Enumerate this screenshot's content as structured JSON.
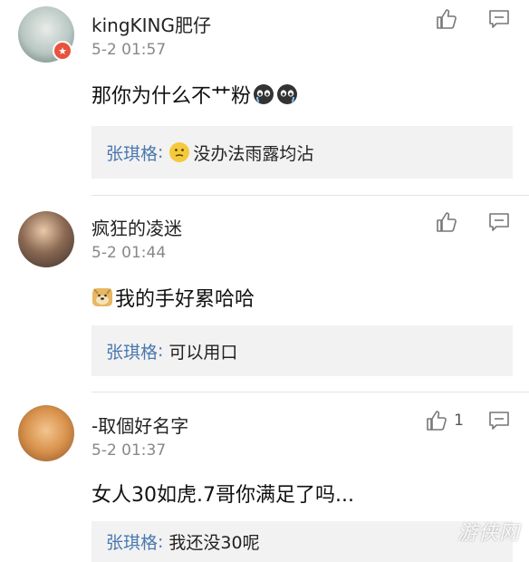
{
  "comments": [
    {
      "username": "kingKING肥仔",
      "time": "5-2 01:57",
      "text": "那你为什么不艹粉",
      "like_count": "",
      "reply": {
        "name": "张琪格",
        "separator": ":",
        "text": "没办法雨露均沾"
      }
    },
    {
      "username": "疯狂的凌迷",
      "time": "5-2 01:44",
      "text": "我的手好累哈哈",
      "like_count": "",
      "reply": {
        "name": "张琪格",
        "separator": ":",
        "text": "可以用口"
      }
    },
    {
      "username": "-取個好名字",
      "time": "5-2 01:37",
      "text": "女人30如虎.7哥你满足了吗...",
      "like_count": "1",
      "reply": {
        "name": "张琪格",
        "separator": ":",
        "text": "我还没30呢"
      }
    }
  ],
  "watermark": "游侠网",
  "icons": {
    "like": "thumbs-up-icon",
    "comment": "comment-icon",
    "verified": "verified-badge-icon"
  },
  "colors": {
    "reply_name": "#4a78b0",
    "reply_bg": "#f2f2f2",
    "time": "#888888",
    "badge": "#e8533d"
  }
}
